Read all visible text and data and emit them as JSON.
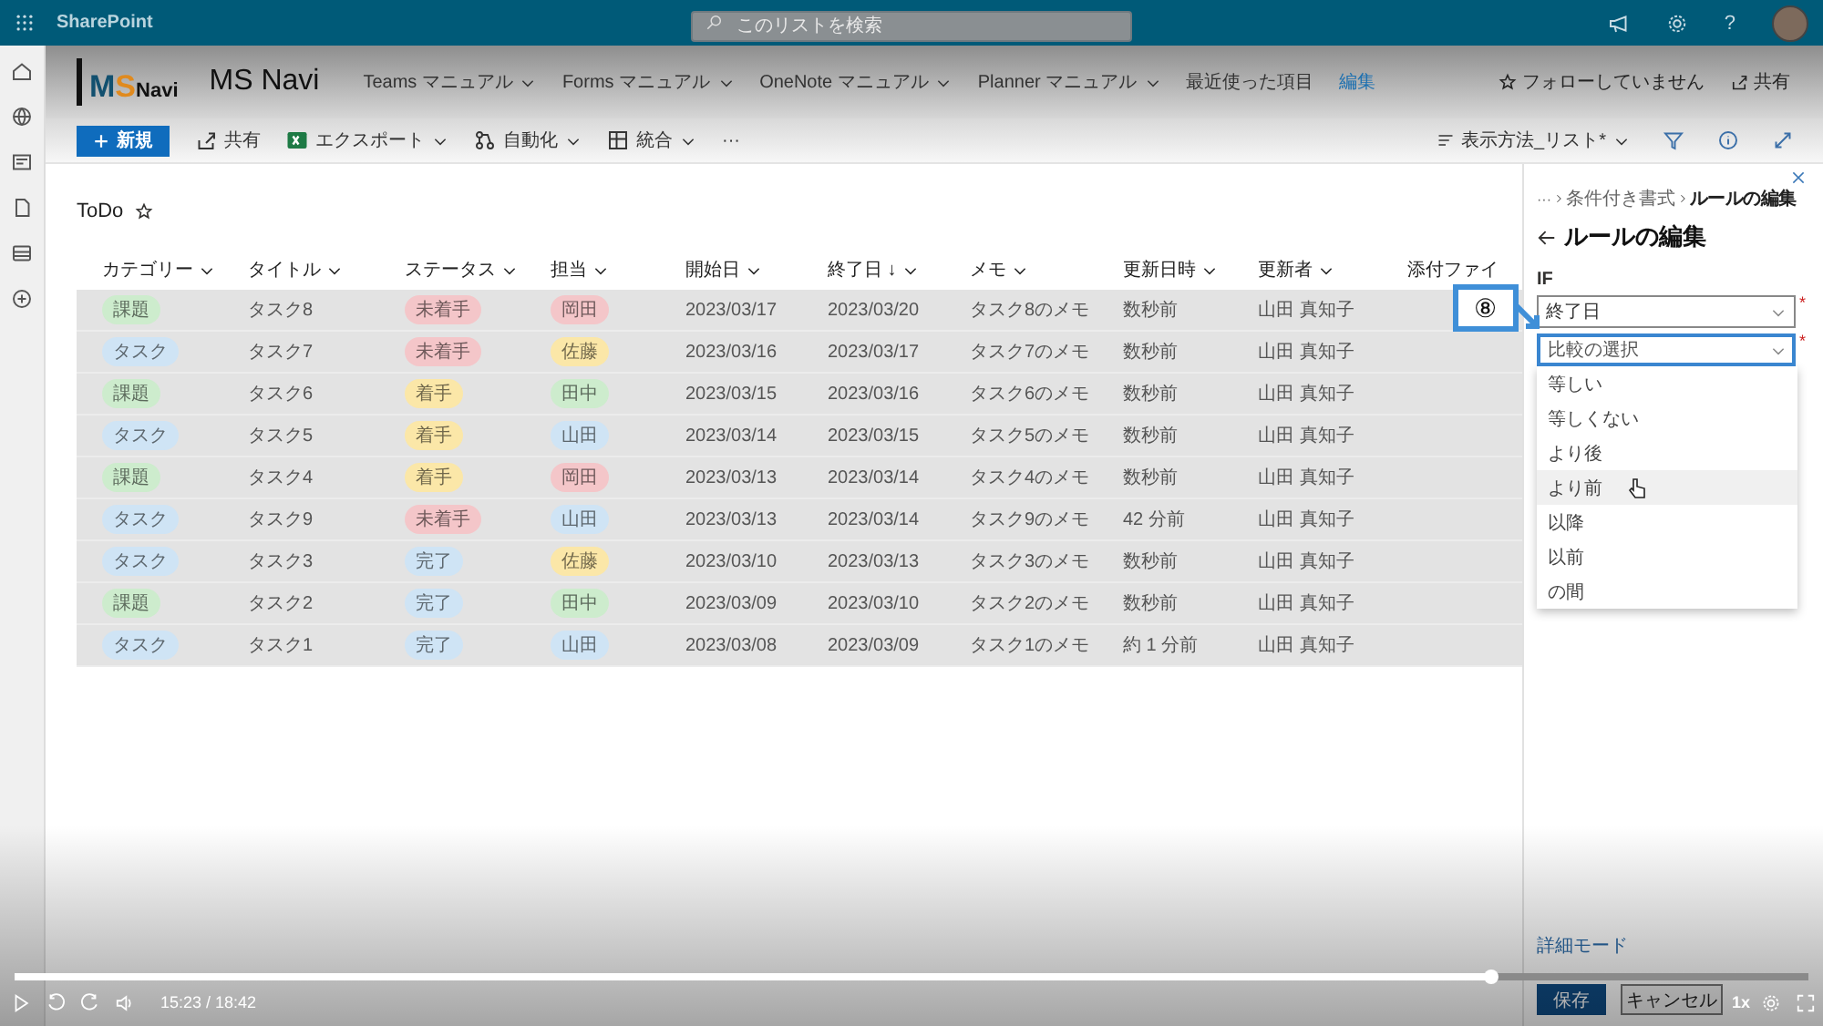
{
  "topbar": {
    "app_name": "SharePoint",
    "search": {
      "placeholder": "このリストを検索"
    },
    "help": "?"
  },
  "site": {
    "logo": [
      "M",
      "S",
      "Navi"
    ],
    "name": "MS Navi",
    "nav": [
      {
        "label": "Teams マニュアル",
        "kind": "menu"
      },
      {
        "label": "Forms マニュアル",
        "kind": "menu"
      },
      {
        "label": "OneNote マニュアル",
        "kind": "menu"
      },
      {
        "label": "Planner マニュアル",
        "kind": "menu"
      },
      {
        "label": "最近使った項目",
        "kind": "plain"
      },
      {
        "label": "編集",
        "kind": "link"
      }
    ],
    "follow": "フォローしていません",
    "share": "共有"
  },
  "commands": {
    "new": "新規",
    "items": [
      {
        "label": "共有",
        "kind": "share"
      },
      {
        "label": "エクスポート",
        "kind": "export"
      },
      {
        "label": "自動化",
        "kind": "automate"
      },
      {
        "label": "統合",
        "kind": "integrate"
      }
    ],
    "more": "···",
    "view": "表示方法_リスト*"
  },
  "list": {
    "title": "ToDo",
    "columns": [
      {
        "label": "カテゴリー"
      },
      {
        "label": "タイトル"
      },
      {
        "label": "ステータス"
      },
      {
        "label": "担当"
      },
      {
        "label": "開始日"
      },
      {
        "label": "終了日",
        "sort_mark": "↓"
      },
      {
        "label": "メモ"
      },
      {
        "label": "更新日時"
      },
      {
        "label": "更新者"
      },
      {
        "label": "添付ファイ"
      }
    ],
    "rows": [
      {
        "category": {
          "text": "課題",
          "color": "#cdeccd"
        },
        "title": "タスク8",
        "status": {
          "text": "未着手",
          "color": "#f4c6c9"
        },
        "assignee": {
          "text": "岡田",
          "color": "#f4c6c9"
        },
        "start": "2023/03/17",
        "end": "2023/03/20",
        "memo": "タスク8のメモ",
        "modified": "数秒前",
        "modified_by": "山田 真知子"
      },
      {
        "category": {
          "text": "タスク",
          "color": "#cfe4f5"
        },
        "title": "タスク7",
        "status": {
          "text": "未着手",
          "color": "#f4c6c9"
        },
        "assignee": {
          "text": "佐藤",
          "color": "#fbe7a8"
        },
        "start": "2023/03/16",
        "end": "2023/03/17",
        "memo": "タスク7のメモ",
        "modified": "数秒前",
        "modified_by": "山田 真知子"
      },
      {
        "category": {
          "text": "課題",
          "color": "#cdeccd"
        },
        "title": "タスク6",
        "status": {
          "text": "着手",
          "color": "#fbe7a8"
        },
        "assignee": {
          "text": "田中",
          "color": "#cdeccd"
        },
        "start": "2023/03/15",
        "end": "2023/03/16",
        "memo": "タスク6のメモ",
        "modified": "数秒前",
        "modified_by": "山田 真知子"
      },
      {
        "category": {
          "text": "タスク",
          "color": "#cfe4f5"
        },
        "title": "タスク5",
        "status": {
          "text": "着手",
          "color": "#fbe7a8"
        },
        "assignee": {
          "text": "山田",
          "color": "#cfe4f5"
        },
        "start": "2023/03/14",
        "end": "2023/03/15",
        "memo": "タスク5のメモ",
        "modified": "数秒前",
        "modified_by": "山田 真知子"
      },
      {
        "category": {
          "text": "課題",
          "color": "#cdeccd"
        },
        "title": "タスク4",
        "status": {
          "text": "着手",
          "color": "#fbe7a8"
        },
        "assignee": {
          "text": "岡田",
          "color": "#f4c6c9"
        },
        "start": "2023/03/13",
        "end": "2023/03/14",
        "memo": "タスク4のメモ",
        "modified": "数秒前",
        "modified_by": "山田 真知子"
      },
      {
        "category": {
          "text": "タスク",
          "color": "#cfe4f5"
        },
        "title": "タスク9",
        "status": {
          "text": "未着手",
          "color": "#f4c6c9"
        },
        "assignee": {
          "text": "山田",
          "color": "#cfe4f5"
        },
        "start": "2023/03/13",
        "end": "2023/03/14",
        "memo": "タスク9のメモ",
        "modified": "42 分前",
        "modified_by": "山田 真知子"
      },
      {
        "category": {
          "text": "タスク",
          "color": "#cfe4f5"
        },
        "title": "タスク3",
        "status": {
          "text": "完了",
          "color": "#cfe4f5"
        },
        "assignee": {
          "text": "佐藤",
          "color": "#fbe7a8"
        },
        "start": "2023/03/10",
        "end": "2023/03/13",
        "memo": "タスク3のメモ",
        "modified": "数秒前",
        "modified_by": "山田 真知子"
      },
      {
        "category": {
          "text": "課題",
          "color": "#cdeccd"
        },
        "title": "タスク2",
        "status": {
          "text": "完了",
          "color": "#cfe4f5"
        },
        "assignee": {
          "text": "田中",
          "color": "#cdeccd"
        },
        "start": "2023/03/09",
        "end": "2023/03/10",
        "memo": "タスク2のメモ",
        "modified": "数秒前",
        "modified_by": "山田 真知子"
      },
      {
        "category": {
          "text": "タスク",
          "color": "#cfe4f5"
        },
        "title": "タスク1",
        "status": {
          "text": "完了",
          "color": "#cfe4f5"
        },
        "assignee": {
          "text": "山田",
          "color": "#cfe4f5"
        },
        "start": "2023/03/08",
        "end": "2023/03/09",
        "memo": "タスク1のメモ",
        "modified": "約 1 分前",
        "modified_by": "山田 真知子"
      }
    ]
  },
  "panel": {
    "breadcrumb": [
      "···",
      "条件付き書式",
      "ルールの編集"
    ],
    "title": "ルールの編集",
    "if_label": "IF",
    "fields": [
      {
        "value": "終了日",
        "required_mark": "*",
        "focused": false
      },
      {
        "placeholder": "比較の選択",
        "required_mark": "*",
        "focused": true
      }
    ],
    "options": [
      {
        "label": "等しい",
        "selected": false
      },
      {
        "label": "等しくない",
        "selected": false
      },
      {
        "label": "より後",
        "selected": false
      },
      {
        "label": "より前",
        "selected": true
      },
      {
        "label": "以降",
        "selected": false
      },
      {
        "label": "以前",
        "selected": false
      },
      {
        "label": "の間",
        "selected": false
      }
    ],
    "advanced": "詳細モード",
    "save": "保存",
    "cancel": "キャンセル"
  },
  "annotation": {
    "label": "⑧"
  },
  "player": {
    "time": "15:23 / 18:42",
    "level": 0.823,
    "speed": "1x"
  }
}
